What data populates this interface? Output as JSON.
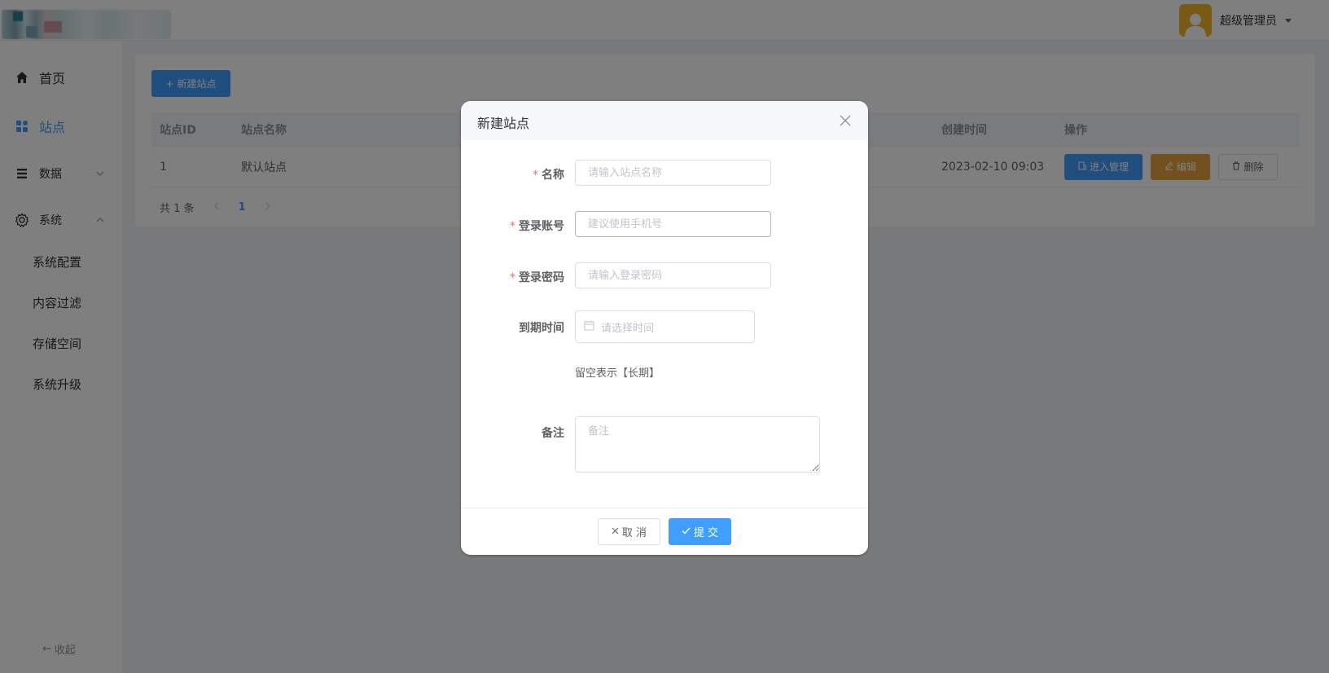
{
  "header": {
    "user_name": "超级管理员",
    "avatar_icon": "user-avatar-icon"
  },
  "sidebar": {
    "items": [
      {
        "label": "首页",
        "icon": "home-icon"
      },
      {
        "label": "站点",
        "icon": "grid-icon",
        "active": true
      },
      {
        "label": "数据",
        "icon": "list-icon",
        "expanded": false
      },
      {
        "label": "系统",
        "icon": "gear-icon",
        "expanded": true
      }
    ],
    "sub_items": [
      "系统配置",
      "内容过滤",
      "存储空间",
      "系统升级"
    ],
    "collapse_label": "收起"
  },
  "toolbar": {
    "new_site_label": "新建站点"
  },
  "table": {
    "columns": [
      "站点ID",
      "站点名称",
      "创建时间",
      "操作"
    ],
    "rows": [
      {
        "id": "1",
        "name": "默认站点",
        "created": "2023-02-10 09:03"
      }
    ],
    "actions": {
      "manage": "进入管理",
      "edit": "编辑",
      "delete": "删除"
    }
  },
  "pagination": {
    "total": "共 1 条",
    "current_page": "1"
  },
  "dialog": {
    "title": "新建站点",
    "fields": {
      "name_label": "名称",
      "name_placeholder": "请输入站点名称",
      "account_label": "登录账号",
      "account_placeholder": "建议使用手机号",
      "password_label": "登录密码",
      "password_placeholder": "请输入登录密码",
      "expire_label": "到期时间",
      "expire_placeholder": "请选择时间",
      "expire_hint": "留空表示【长期】",
      "remark_label": "备注",
      "remark_placeholder": "备注"
    },
    "required_mark": "*",
    "cancel_label": "取 消",
    "submit_label": "提 交"
  },
  "colors": {
    "primary": "#409eff",
    "warning": "#e6a23c",
    "danger_mark": "#f56c6c",
    "avatar_bg": "#f0b429"
  }
}
